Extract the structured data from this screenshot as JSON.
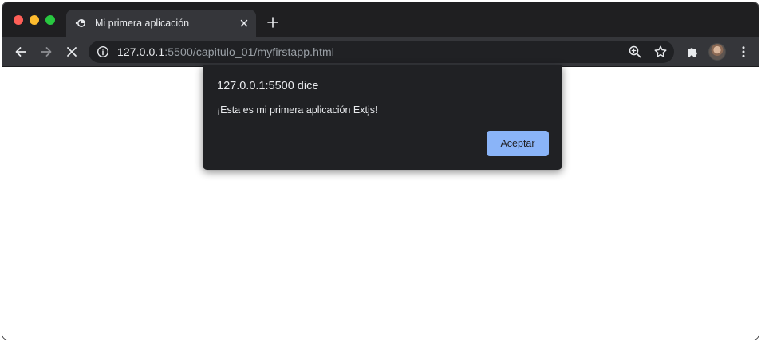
{
  "colors": {
    "tabstrip_bg": "#1f1f21",
    "toolbar_bg": "#35363a",
    "omnibox_bg": "#202124",
    "dialog_bg": "#202124",
    "accent_button": "#8ab4f8",
    "traffic_close": "#ff5f57",
    "traffic_minimize": "#febc2e",
    "traffic_maximize": "#28c840"
  },
  "tab": {
    "title": "Mi primera aplicación",
    "favicon": "loading-icon"
  },
  "toolbar": {
    "icons": [
      "back-arrow-icon",
      "forward-arrow-icon",
      "stop-loading-icon",
      "extensions-puzzle-icon",
      "profile-avatar",
      "menu-kebab-icon"
    ]
  },
  "omnibox": {
    "url_host": "127.0.0.1",
    "url_rest": ":5500/capitulo_01/myfirstapp.html",
    "icons": [
      "site-info-icon",
      "zoom-icon",
      "bookmark-star-icon"
    ]
  },
  "dialog": {
    "title": "127.0.0.1:5500 dice",
    "message": "¡Esta es mi primera aplicación Extjs!",
    "button_label": "Aceptar"
  }
}
